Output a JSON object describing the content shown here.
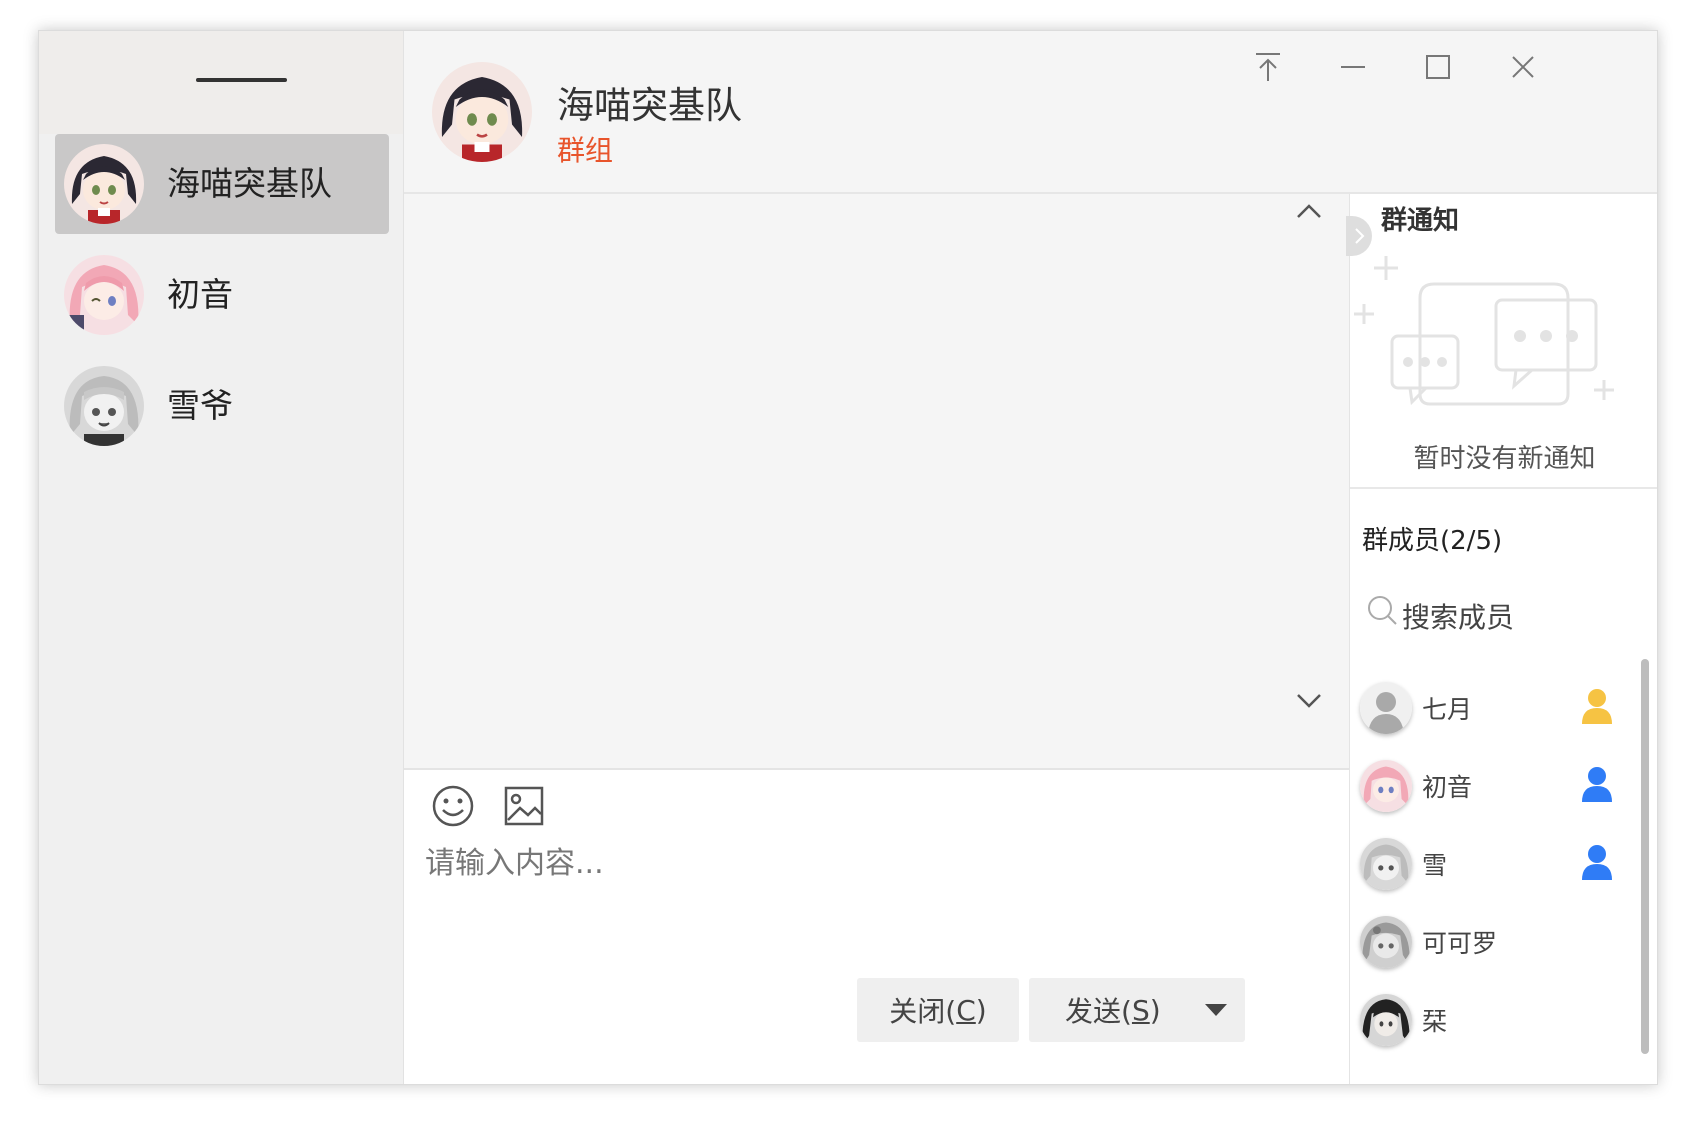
{
  "sidebar": {
    "contacts": [
      {
        "name": "海喵突基队",
        "active": true
      },
      {
        "name": "初音",
        "active": false
      },
      {
        "name": "雪爷",
        "active": false
      }
    ]
  },
  "header": {
    "title": "海喵突基队",
    "subtitle": "群组"
  },
  "composer": {
    "placeholder": "请输入内容...",
    "close_label": "关闭(",
    "close_key": "C",
    "close_end": ")",
    "send_label": "发送(",
    "send_key": "S",
    "send_end": ")"
  },
  "notice": {
    "title": "群通知",
    "empty_text": "暂时没有新通知"
  },
  "members": {
    "title": "群成员(2/5)",
    "search_placeholder": "搜索成员",
    "items": [
      {
        "name": "七月",
        "role": "owner"
      },
      {
        "name": "初音",
        "role": "admin"
      },
      {
        "name": "雪",
        "role": "admin"
      },
      {
        "name": "可可罗",
        "role": "member"
      },
      {
        "name": "栞",
        "role": "member"
      }
    ]
  },
  "colors": {
    "accent_orange": "#e8542b",
    "owner_yellow": "#f6c343",
    "admin_blue": "#2f7cf6",
    "active_item": "#c9c8c8"
  }
}
